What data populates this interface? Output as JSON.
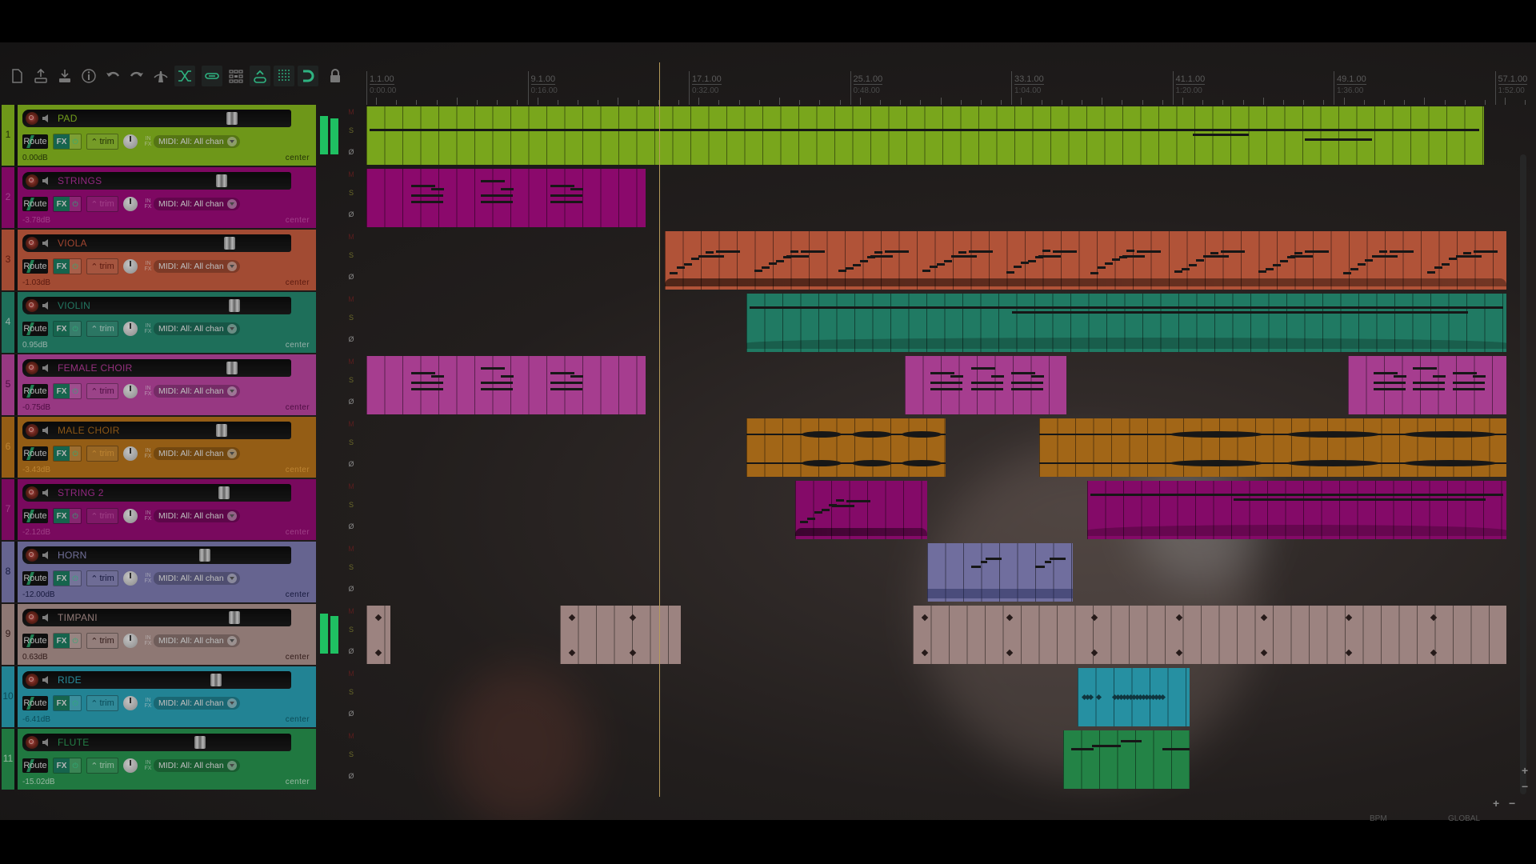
{
  "toolbar": {
    "buttons": [
      {
        "name": "new-project-icon",
        "active": false
      },
      {
        "name": "open-project-icon",
        "active": false
      },
      {
        "name": "save-project-icon",
        "active": false
      },
      {
        "name": "project-info-icon",
        "active": false
      },
      {
        "name": "undo-icon",
        "active": false
      },
      {
        "name": "redo-icon",
        "active": false
      },
      {
        "name": "metronome-icon",
        "active": false
      },
      {
        "name": "auto-crossfade-icon",
        "active": true
      },
      {
        "name": "item-grouping-icon",
        "active": true
      },
      {
        "name": "grid-icon",
        "active": false
      },
      {
        "name": "ripple-edit-icon",
        "active": true
      },
      {
        "name": "snap-lines-icon",
        "active": true
      },
      {
        "name": "snap-magnet-icon",
        "active": true
      },
      {
        "name": "lock-icon",
        "active": false
      }
    ]
  },
  "ruler": {
    "marks": [
      {
        "bar": "1.1.00",
        "time": "0:00.00"
      },
      {
        "bar": "9.1.00",
        "time": "0:16.00"
      },
      {
        "bar": "17.1.00",
        "time": "0:32.00"
      },
      {
        "bar": "25.1.00",
        "time": "0:48.00"
      },
      {
        "bar": "33.1.00",
        "time": "1:04.00"
      },
      {
        "bar": "41.1.00",
        "time": "1:20.00"
      },
      {
        "bar": "49.1.00",
        "time": "1:36.00"
      },
      {
        "bar": "57.1.00",
        "time": "1:52.00"
      }
    ]
  },
  "common": {
    "route_label": "Route",
    "fx_label": "FX",
    "fx_power": "⏻",
    "trim_label": "trim",
    "in_label": "IN",
    "fx_small": "FX",
    "midi_input": "MIDI: All: All chan",
    "mute": "M",
    "solo": "S",
    "phase": "Ø"
  },
  "tracks": [
    {
      "num": "1",
      "name": "PAD",
      "volume": "0.00dB",
      "pan": "center",
      "color": "#86b81f",
      "text": "#2b3d08",
      "name_color": "#8bbf22",
      "fader": 0.78,
      "meter": [
        0.92,
        0.86
      ]
    },
    {
      "num": "2",
      "name": "STRINGS",
      "volume": "-3.78dB",
      "pan": "center",
      "color": "#9a0a78",
      "text": "#c54fa8",
      "name_color": "#b0309a",
      "fader": 0.74,
      "meter": null
    },
    {
      "num": "3",
      "name": "VIOLA",
      "volume": "-1.03dB",
      "pan": "center",
      "color": "#c55c3e",
      "text": "#6e1e12",
      "name_color": "#c2543a",
      "fader": 0.77,
      "meter": null
    },
    {
      "num": "4",
      "name": "VIOLIN",
      "volume": "0.95dB",
      "pan": "center",
      "color": "#24876e",
      "text": "#b9d9cf",
      "name_color": "#2a8f75",
      "fader": 0.79,
      "meter": null
    },
    {
      "num": "5",
      "name": "FEMALE CHOIR",
      "volume": "-0.75dB",
      "pan": "center",
      "color": "#b8449f",
      "text": "#5e1050",
      "name_color": "#b43a99",
      "fader": 0.78,
      "meter": null
    },
    {
      "num": "6",
      "name": "MALE CHOIR",
      "volume": "-3.43dB",
      "pan": "center",
      "color": "#b4711a",
      "text": "#e6a13d",
      "name_color": "#a8681a",
      "fader": 0.74,
      "meter": null
    },
    {
      "num": "7",
      "name": "STRING 2",
      "volume": "-2.12dB",
      "pan": "center",
      "color": "#930b73",
      "text": "#c24fa4",
      "name_color": "#b0309a",
      "fader": 0.75,
      "meter": null
    },
    {
      "num": "8",
      "name": "HORN",
      "volume": "-12.00dB",
      "pan": "center",
      "color": "#7c7ab0",
      "text": "#1c1f4a",
      "name_color": "#8a88ba",
      "fader": 0.68,
      "meter": null
    },
    {
      "num": "9",
      "name": "TIMPANI",
      "volume": "0.63dB",
      "pan": "center",
      "color": "#ad928e",
      "text": "#3d2220",
      "name_color": "#b09490",
      "fader": 0.79,
      "meter": [
        0.96,
        0.9
      ]
    },
    {
      "num": "10",
      "name": "RIDE",
      "volume": "-6.41dB",
      "pan": "center",
      "color": "#2aa0b4",
      "text": "#0e5c6b",
      "name_color": "#2fa8bc",
      "fader": 0.72,
      "meter": null
    },
    {
      "num": "11",
      "name": "FLUTE",
      "volume": "-15.02dB",
      "pan": "center",
      "color": "#27924e",
      "text": "#b8e0c4",
      "name_color": "#2b9a55",
      "fader": 0.66,
      "meter": null
    }
  ],
  "items": [
    {
      "track": 0,
      "start": 0.0,
      "end": 0.98,
      "type": "midi-sustain"
    },
    {
      "track": 1,
      "start": 0.0,
      "end": 0.245,
      "type": "midi-chords"
    },
    {
      "track": 2,
      "start": 0.262,
      "end": 1.0,
      "type": "midi-arp"
    },
    {
      "track": 3,
      "start": 0.333,
      "end": 1.0,
      "type": "midi-long"
    },
    {
      "track": 4,
      "start": 0.0,
      "end": 0.245,
      "type": "midi-chords"
    },
    {
      "track": 4,
      "start": 0.472,
      "end": 0.614,
      "type": "midi-chords"
    },
    {
      "track": 4,
      "start": 0.861,
      "end": 1.0,
      "type": "midi-chords"
    },
    {
      "track": 5,
      "start": 0.333,
      "end": 0.508,
      "type": "audio"
    },
    {
      "track": 5,
      "start": 0.59,
      "end": 1.0,
      "type": "audio"
    },
    {
      "track": 6,
      "start": 0.376,
      "end": 0.492,
      "type": "midi-arp"
    },
    {
      "track": 6,
      "start": 0.632,
      "end": 1.0,
      "type": "midi-long"
    },
    {
      "track": 7,
      "start": 0.492,
      "end": 0.62,
      "type": "midi-horn"
    },
    {
      "track": 8,
      "start": 0.0,
      "end": 0.021,
      "type": "midi-hits"
    },
    {
      "track": 8,
      "start": 0.17,
      "end": 0.276,
      "type": "midi-hits"
    },
    {
      "track": 8,
      "start": 0.479,
      "end": 1.0,
      "type": "midi-hits"
    },
    {
      "track": 9,
      "start": 0.624,
      "end": 0.722,
      "type": "midi-ride"
    },
    {
      "track": 10,
      "start": 0.611,
      "end": 0.722,
      "type": "midi-flute"
    }
  ],
  "transport": {
    "bpm_label": "BPM",
    "global_label": "GLOBAL"
  }
}
